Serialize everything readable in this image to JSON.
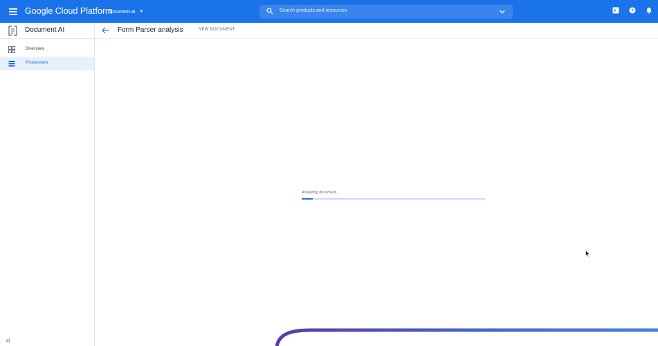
{
  "topbar": {
    "brand": "Google Cloud Platform",
    "project": "document-ai",
    "search_placeholder": "Search products and resources",
    "icons": [
      "menu-icon",
      "terminal-icon",
      "help-icon",
      "notifications-icon"
    ]
  },
  "sidebar": {
    "title": "Document AI",
    "items": [
      {
        "label": "Overview",
        "icon": "overview-icon",
        "active": false
      },
      {
        "label": "Processors",
        "icon": "processors-icon",
        "active": true
      }
    ],
    "collapse_label": "≤|"
  },
  "main": {
    "title": "Form Parser analysis",
    "new_document": "NEW DOCUMENT",
    "status_text": "Analyzing document...",
    "progress": 0.06
  },
  "colors": {
    "brand_blue": "#1a73e8",
    "active_bg": "#e8f0fe",
    "progress_track": "#c6dafc"
  }
}
